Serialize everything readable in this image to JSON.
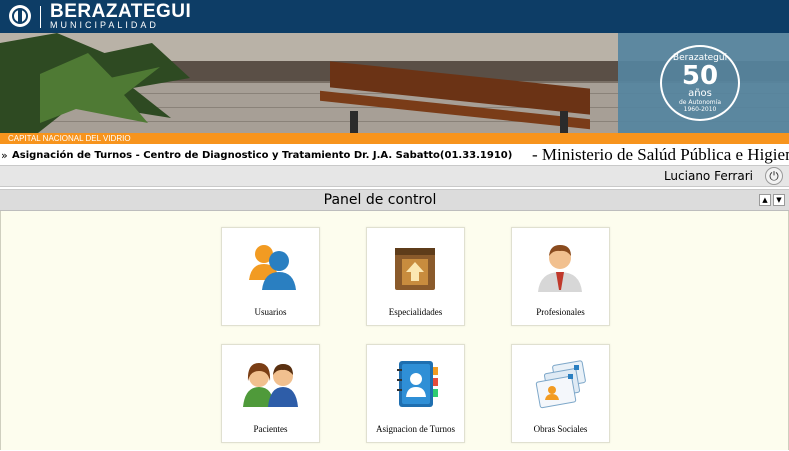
{
  "header": {
    "brand_name": "BERAZATEGUI",
    "brand_sub": "MUNICIPALIDAD",
    "banner_strip": "CAPITAL NACIONAL DEL VIDRIO",
    "badge": {
      "top": "Berazategui",
      "number": "50",
      "anos": "años",
      "line1": "de Autonomía",
      "line2": "1960-2010"
    }
  },
  "app": {
    "breadcrumb_arrow": "»",
    "title": "Asignación de Turnos - Centro de Diagnostico y Tratamiento Dr. J.A. Sabatto(01.33.1910)",
    "ministry": "- Ministerio de Salúd Pública e Higiene"
  },
  "user": {
    "name": "Luciano Ferrari",
    "logout_icon": "power-icon"
  },
  "panel": {
    "title": "Panel de control",
    "collapse_up": "▲",
    "collapse_down": "▼"
  },
  "tiles": [
    {
      "label": "Usuarios",
      "icon": "users-icon"
    },
    {
      "label": "Especialidades",
      "icon": "box-icon"
    },
    {
      "label": "Profesionales",
      "icon": "professional-icon"
    },
    {
      "label": "Pacientes",
      "icon": "patients-icon"
    },
    {
      "label": "Asignacion de Turnos",
      "icon": "address-book-icon"
    },
    {
      "label": "Obras Sociales",
      "icon": "cards-icon"
    }
  ],
  "colors": {
    "header_bg": "#0d3d66",
    "strip": "#f7941d",
    "content_bg": "#fdfdee",
    "bar_gray": "#e6e6e6"
  }
}
